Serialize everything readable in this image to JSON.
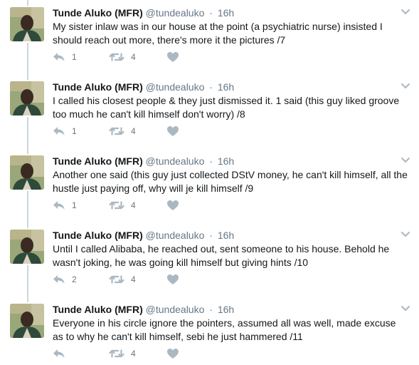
{
  "colors": {
    "name": "#14171a",
    "meta": "#657786",
    "icon": "#aab8c2",
    "thread_line": "#ccd6dd"
  },
  "icons": {
    "reply": "reply-icon",
    "retweet": "retweet-icon",
    "like": "heart-icon",
    "menu": "chevron-down-icon"
  },
  "tweets": [
    {
      "author": "Tunde Aluko (MFR)",
      "handle": "@tundealuko",
      "separator": "·",
      "time": "16h",
      "text": "My sister inlaw was in our house at the point (a psychiatric nurse) insisted I should reach out more, there's more it the pictures /7",
      "replies": "1",
      "retweets": "4",
      "likes": ""
    },
    {
      "author": "Tunde Aluko (MFR)",
      "handle": "@tundealuko",
      "separator": "·",
      "time": "16h",
      "text": "I called his closest people & they just dismissed it. 1 said (this guy liked groove too much he can't kill himself don't worry) /8",
      "replies": "1",
      "retweets": "4",
      "likes": ""
    },
    {
      "author": "Tunde Aluko (MFR)",
      "handle": "@tundealuko",
      "separator": "·",
      "time": "16h",
      "text": "Another one said (this guy just collected DStV money, he can't kill himself, all the hustle just paying off, why will je kill himself /9",
      "replies": "1",
      "retweets": "4",
      "likes": ""
    },
    {
      "author": "Tunde Aluko (MFR)",
      "handle": "@tundealuko",
      "separator": "·",
      "time": "16h",
      "text": "Until I called Alibaba, he reached out, sent someone to his house. Behold he wasn't joking, he was going kill himself but giving hints /10",
      "replies": "2",
      "retweets": "4",
      "likes": ""
    },
    {
      "author": "Tunde Aluko (MFR)",
      "handle": "@tundealuko",
      "separator": "·",
      "time": "16h",
      "text": "Everyone in his circle ignore the pointers, assumed all was well, made excuse as to why he can't kill himself, sebi he just hammered /11",
      "replies": "",
      "retweets": "4",
      "likes": ""
    }
  ]
}
